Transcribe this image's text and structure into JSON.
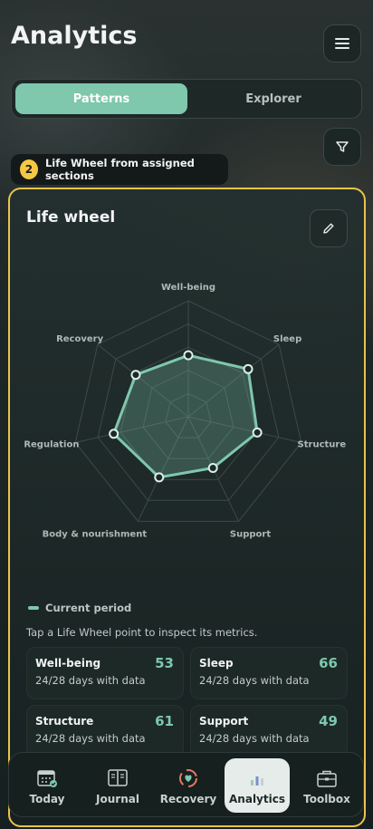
{
  "header": {
    "title": "Analytics"
  },
  "segmented": {
    "tabs": [
      {
        "label": "Patterns",
        "active": true
      },
      {
        "label": "Explorer",
        "active": false
      }
    ]
  },
  "tooltip": {
    "step": "2",
    "text": "Life Wheel from assigned sections"
  },
  "card": {
    "title": "Life wheel",
    "legend_label": "Current period",
    "hint": "Tap a Life Wheel point to inspect its metrics."
  },
  "chart_data": {
    "type": "radar",
    "axes": [
      "Well-being",
      "Sleep",
      "Structure",
      "Support",
      "Body & nourishment",
      "Regulation",
      "Recovery"
    ],
    "series": [
      {
        "name": "Current period",
        "values": [
          53,
          66,
          61,
          49,
          58,
          66,
          58
        ]
      }
    ],
    "range": [
      0,
      100
    ],
    "grid_levels": 5
  },
  "metrics": [
    {
      "name": "Well-being",
      "value": "53",
      "sub": "24/28 days with data"
    },
    {
      "name": "Sleep",
      "value": "66",
      "sub": "24/28 days with data"
    },
    {
      "name": "Structure",
      "value": "61",
      "sub": "24/28 days with data"
    },
    {
      "name": "Support",
      "value": "49",
      "sub": "24/28 days with data"
    }
  ],
  "nav": [
    {
      "label": "Today",
      "icon": "calendar-icon",
      "active": false
    },
    {
      "label": "Journal",
      "icon": "book-icon",
      "active": false
    },
    {
      "label": "Recovery",
      "icon": "heart-ring-icon",
      "active": false
    },
    {
      "label": "Analytics",
      "icon": "bar-chart-icon",
      "active": true
    },
    {
      "label": "Toolbox",
      "icon": "briefcase-icon",
      "active": false
    }
  ],
  "colors": {
    "accent": "#7fc7ad",
    "highlight": "#e9c44a",
    "badge": "#f5c842"
  }
}
